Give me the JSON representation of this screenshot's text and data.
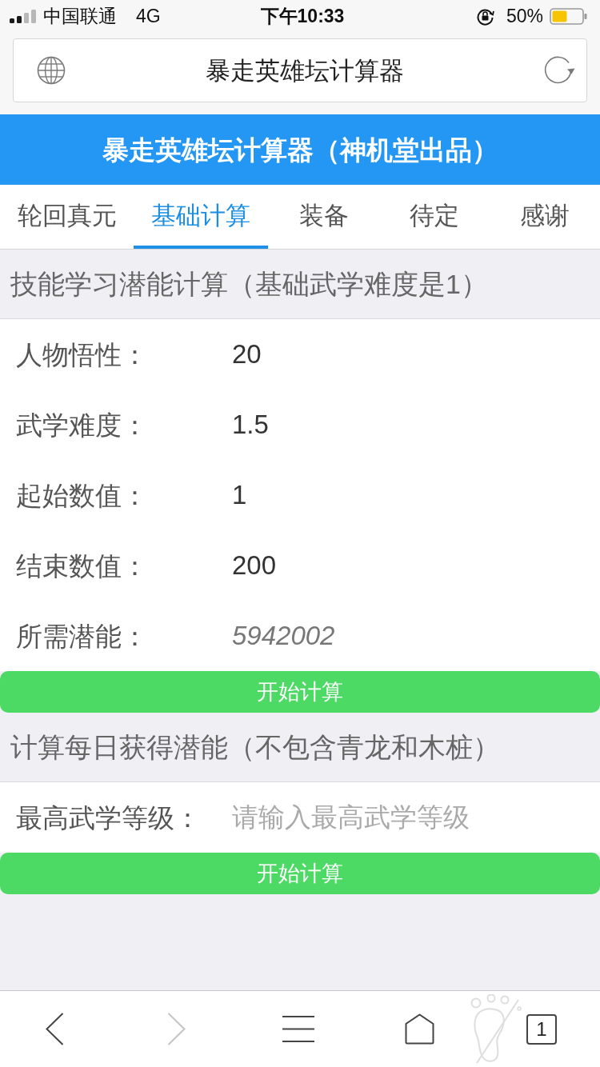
{
  "status_bar": {
    "carrier": "中国联通",
    "network": "4G",
    "time": "下午10:33",
    "battery": "50%"
  },
  "address_bar": {
    "title": "暴走英雄坛计算器"
  },
  "header": {
    "title": "暴走英雄坛计算器（神机堂出品）"
  },
  "tabs": [
    {
      "label": "轮回真元",
      "selected": false
    },
    {
      "label": "基础计算",
      "selected": true
    },
    {
      "label": "装备",
      "selected": false
    },
    {
      "label": "待定",
      "selected": false
    },
    {
      "label": "感谢",
      "selected": false
    }
  ],
  "sections": [
    {
      "heading": "技能学习潜能计算（基础武学难度是1）",
      "fields": [
        {
          "kind": "input",
          "label": "人物悟性：",
          "value": "20"
        },
        {
          "kind": "input",
          "label": "武学难度：",
          "value": "1.5"
        },
        {
          "kind": "input",
          "label": "起始数值：",
          "value": "1"
        },
        {
          "kind": "input",
          "label": "结束数值：",
          "value": "200"
        },
        {
          "kind": "result",
          "label": "所需潜能：",
          "value": "5942002"
        }
      ],
      "button": "开始计算"
    },
    {
      "heading": "计算每日获得潜能（不包含青龙和木桩）",
      "fields": [
        {
          "kind": "input",
          "label": "最高武学等级：",
          "placeholder": "请输入最高武学等级"
        }
      ],
      "button": "开始计算"
    }
  ],
  "toolbar": [
    {
      "kind": "back",
      "disabled": false
    },
    {
      "kind": "forward",
      "disabled": true
    },
    {
      "kind": "menu",
      "disabled": false
    },
    {
      "kind": "home",
      "disabled": false
    },
    {
      "kind": "tabs",
      "disabled": false,
      "count": "1"
    }
  ]
}
